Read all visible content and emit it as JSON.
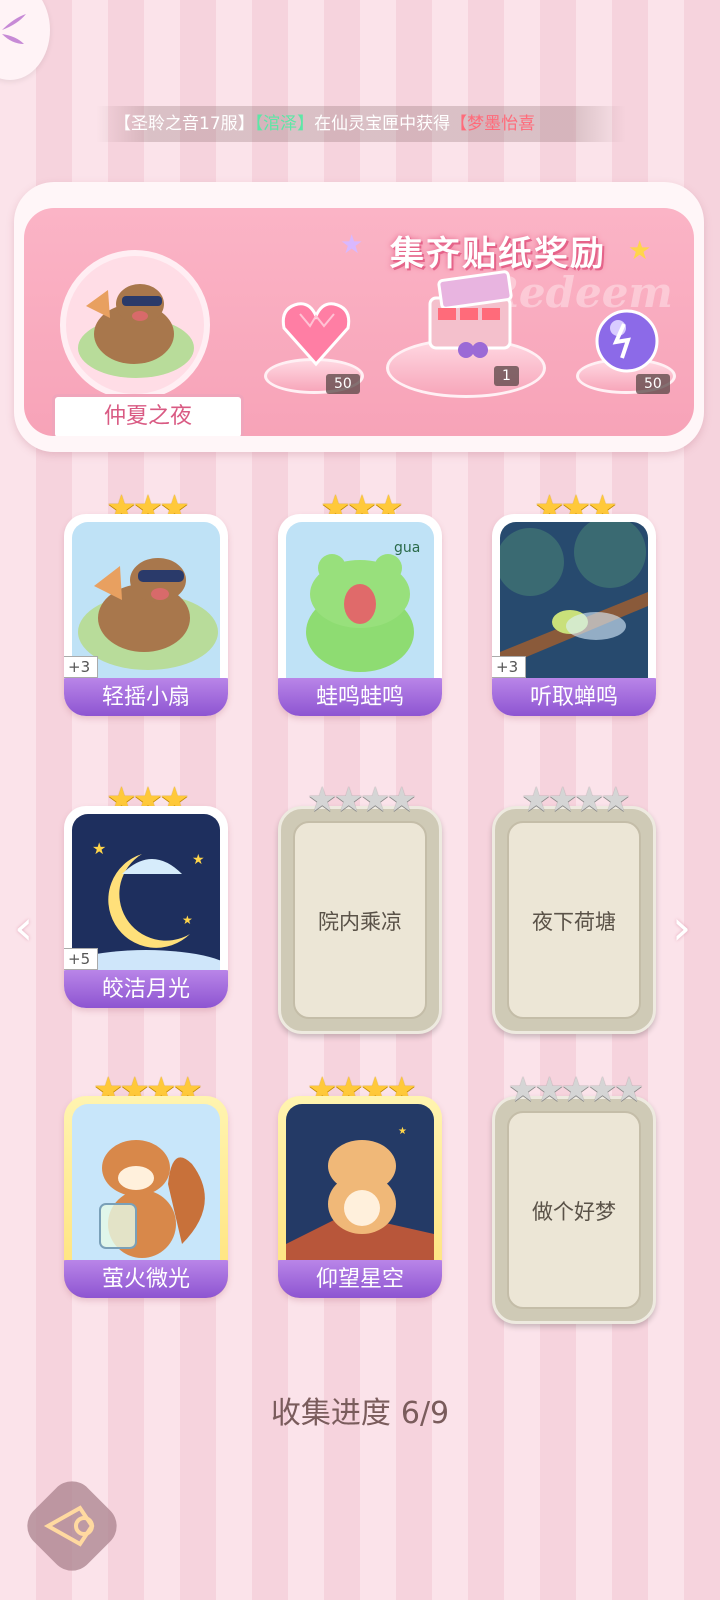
{
  "ticker": {
    "server": "【圣聆之音17服】",
    "player": "【涫泽】",
    "action": "在仙灵宝匣中获得",
    "item": "【梦墨怡喜"
  },
  "banner": {
    "title": "集齐贴纸奖励",
    "watermark": "Redeem",
    "avatar_name": "仲夏之夜",
    "rewards": [
      {
        "icon": "pink-heart-gem-icon",
        "count": "50"
      },
      {
        "icon": "gift-box-icon",
        "count": "1"
      },
      {
        "icon": "purple-orb-icon",
        "count": "50"
      }
    ]
  },
  "cards": [
    {
      "name": "轻摇小扇",
      "stars": 3,
      "plus": "+3",
      "state": "owned"
    },
    {
      "name": "蛙鸣蛙鸣",
      "stars": 3,
      "plus": "",
      "state": "owned"
    },
    {
      "name": "听取蝉鸣",
      "stars": 3,
      "plus": "+3",
      "state": "owned"
    },
    {
      "name": "皎洁月光",
      "stars": 3,
      "plus": "+5",
      "state": "owned"
    },
    {
      "name": "院内乘凉",
      "stars": 4,
      "plus": "",
      "state": "locked"
    },
    {
      "name": "夜下荷塘",
      "stars": 4,
      "plus": "",
      "state": "locked"
    },
    {
      "name": "萤火微光",
      "stars": 4,
      "plus": "",
      "state": "owned-gold"
    },
    {
      "name": "仰望星空",
      "stars": 4,
      "plus": "",
      "state": "owned-gold"
    },
    {
      "name": "做个好梦",
      "stars": 5,
      "plus": "",
      "state": "locked"
    }
  ],
  "progress": {
    "label": "收集进度",
    "value": "6/9"
  },
  "colors": {
    "accent_purple": "#8b52d0",
    "banner_pink": "#f7a3b8",
    "gold_star": "#ffc93a",
    "grey_star": "#d5d5d5"
  }
}
